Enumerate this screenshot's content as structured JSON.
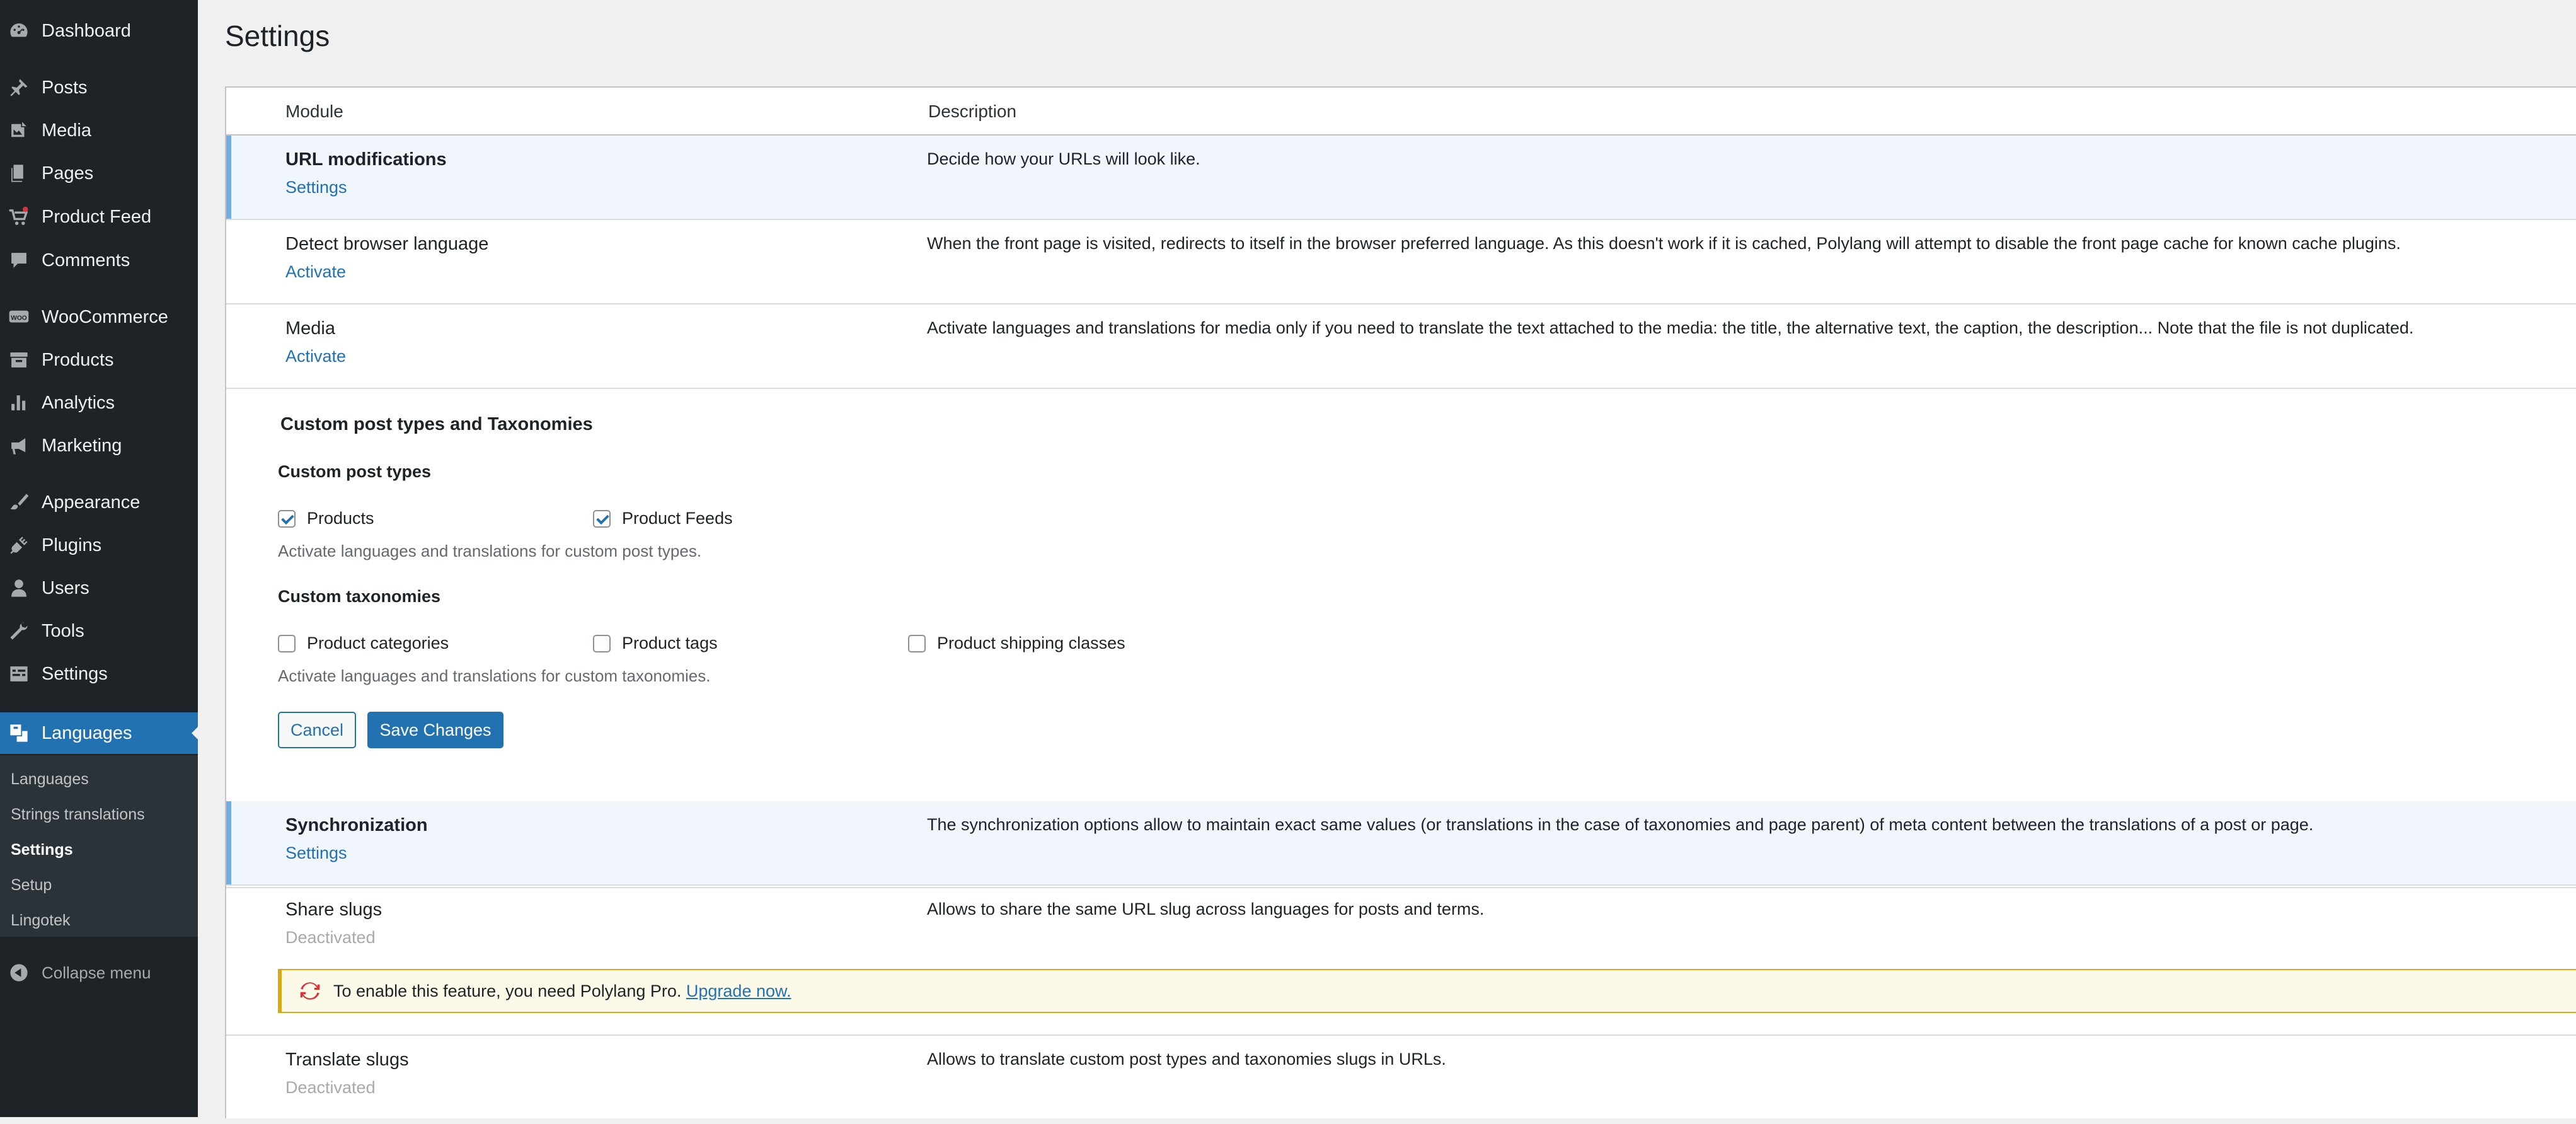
{
  "sidebar": {
    "menu": [
      {
        "label": "Dashboard",
        "icon": "dashboard-icon"
      },
      {
        "label": "Posts",
        "icon": "pin-icon"
      },
      {
        "label": "Media",
        "icon": "media-icon"
      },
      {
        "label": "Pages",
        "icon": "pages-icon"
      },
      {
        "label": "Product Feed",
        "icon": "feed-cart-icon"
      },
      {
        "label": "Comments",
        "icon": "comment-icon"
      },
      {
        "label": "WooCommerce",
        "icon": "woo-icon"
      },
      {
        "label": "Products",
        "icon": "archive-icon"
      },
      {
        "label": "Analytics",
        "icon": "bar-chart-icon"
      },
      {
        "label": "Marketing",
        "icon": "megaphone-icon"
      },
      {
        "label": "Appearance",
        "icon": "brush-icon"
      },
      {
        "label": "Plugins",
        "icon": "plugin-icon"
      },
      {
        "label": "Users",
        "icon": "user-icon"
      },
      {
        "label": "Tools",
        "icon": "wrench-icon"
      },
      {
        "label": "Settings",
        "icon": "settings-icon"
      },
      {
        "label": "Languages",
        "icon": "translation-icon"
      }
    ],
    "submenu": [
      "Languages",
      "Strings translations",
      "Settings",
      "Setup",
      "Lingotek"
    ],
    "collapse_label": "Collapse menu"
  },
  "page": {
    "title": "Settings"
  },
  "table": {
    "col_module": "Module",
    "col_description": "Description",
    "rows": [
      {
        "name": "URL modifications",
        "action": "Settings",
        "description": "Decide how your URLs will look like."
      },
      {
        "name": "Detect browser language",
        "action": "Activate",
        "description": "When the front page is visited, redirects to itself in the browser preferred language. As this doesn't work if it is cached, Polylang will attempt to disable the front page cache for known cache plugins."
      },
      {
        "name": "Media",
        "action": "Activate",
        "description": "Activate languages and translations for media only if you need to translate the text attached to the media: the title, the alternative text, the caption, the description... Note that the file is not duplicated."
      },
      {
        "name": "Synchronization",
        "action": "Settings",
        "description": "The synchronization options allow to maintain exact same values (or translations in the case of taxonomies and page parent) of meta content between the translations of a post or page."
      },
      {
        "name": "Share slugs",
        "action": "Deactivated",
        "description": "Allows to share the same URL slug across languages for posts and terms."
      },
      {
        "name": "Translate slugs",
        "action": "Deactivated",
        "description": "Allows to translate custom post types and taxonomies slugs in URLs."
      }
    ]
  },
  "cpt": {
    "title": "Custom post types and Taxonomies",
    "post_types_heading": "Custom post types",
    "post_types": [
      {
        "label": "Products",
        "checked": true
      },
      {
        "label": "Product Feeds",
        "checked": true
      }
    ],
    "post_types_help": "Activate languages and translations for custom post types.",
    "taxonomies_heading": "Custom taxonomies",
    "taxonomies": [
      {
        "label": "Product categories",
        "checked": false
      },
      {
        "label": "Product tags",
        "checked": false
      },
      {
        "label": "Product shipping classes",
        "checked": false
      }
    ],
    "taxonomies_help": "Activate languages and translations for custom taxonomies.",
    "cancel_label": "Cancel",
    "save_label": "Save Changes"
  },
  "notice": {
    "text": "To enable this feature, you need Polylang Pro.",
    "link": "Upgrade now.",
    "icon": "refresh-icon"
  },
  "colors": {
    "sidebar_bg": "#1d2327",
    "accent": "#2271b1",
    "notice_border": "#dba617",
    "notice_icon": "#d63638"
  }
}
